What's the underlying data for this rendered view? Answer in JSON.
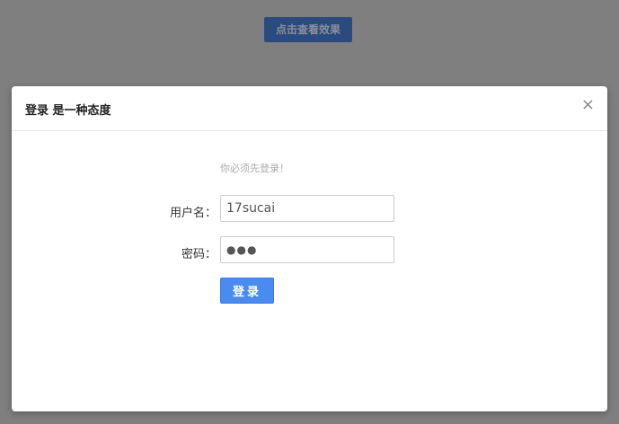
{
  "page": {
    "demo_button": "点击查看效果"
  },
  "modal": {
    "title": "登录 是一种态度",
    "close_icon": "×",
    "hint": "你必须先登录！",
    "username_label": "用户名：",
    "username_value": "17sucai",
    "password_label": "密码：",
    "password_value": "●●●",
    "submit_label": "登录"
  }
}
